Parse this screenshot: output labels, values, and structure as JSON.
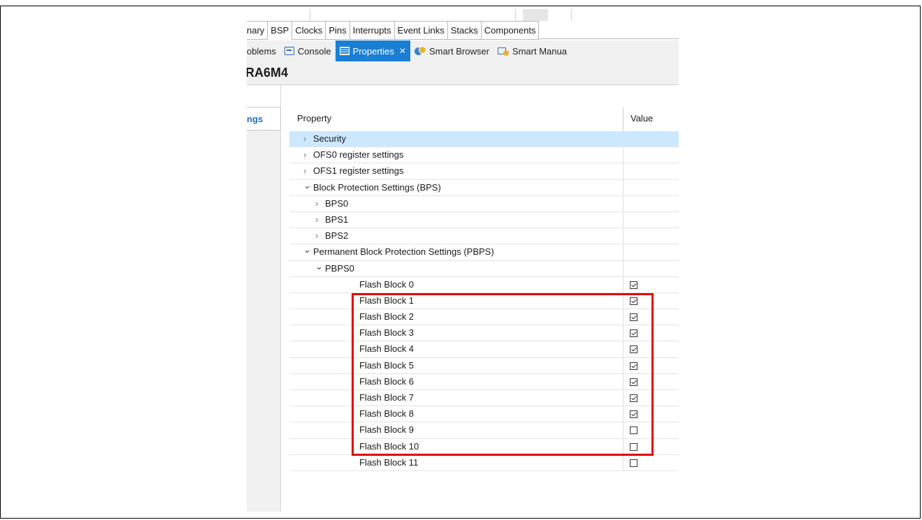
{
  "editor_tabs": [
    "nary",
    "BSP",
    "Clocks",
    "Pins",
    "Interrupts",
    "Event Links",
    "Stacks",
    "Components"
  ],
  "view_tabs": {
    "problems": "oblems",
    "console": "Console",
    "properties": "Properties",
    "smart_browser": "Smart Browser",
    "smart_manual": "Smart Manua"
  },
  "title": "RA6M4",
  "left_tab": "ngs",
  "table": {
    "header_property": "Property",
    "header_value": "Value",
    "rows": [
      {
        "label": "Security",
        "level": 0,
        "expander": "collapsed",
        "selected": true,
        "checkbox": null
      },
      {
        "label": "OFS0 register settings",
        "level": 0,
        "expander": "collapsed",
        "checkbox": null
      },
      {
        "label": "OFS1 register settings",
        "level": 0,
        "expander": "collapsed",
        "checkbox": null
      },
      {
        "label": "Block Protection Settings (BPS)",
        "level": 0,
        "expander": "expanded",
        "checkbox": null
      },
      {
        "label": "BPS0",
        "level": 1,
        "expander": "collapsed",
        "checkbox": null
      },
      {
        "label": "BPS1",
        "level": 1,
        "expander": "collapsed",
        "checkbox": null
      },
      {
        "label": "BPS2",
        "level": 1,
        "expander": "collapsed",
        "checkbox": null
      },
      {
        "label": "Permanent Block Protection Settings (PBPS)",
        "level": 0,
        "expander": "expanded",
        "checkbox": null
      },
      {
        "label": "PBPS0",
        "level": 1,
        "expander": "expanded",
        "checkbox": null
      },
      {
        "label": "Flash Block 0",
        "level": 2,
        "expander": "none",
        "checkbox": true
      },
      {
        "label": "Flash Block 1",
        "level": 2,
        "expander": "none",
        "checkbox": true
      },
      {
        "label": "Flash Block 2",
        "level": 2,
        "expander": "none",
        "checkbox": true
      },
      {
        "label": "Flash Block 3",
        "level": 2,
        "expander": "none",
        "checkbox": true
      },
      {
        "label": "Flash Block 4",
        "level": 2,
        "expander": "none",
        "checkbox": true
      },
      {
        "label": "Flash Block 5",
        "level": 2,
        "expander": "none",
        "checkbox": true
      },
      {
        "label": "Flash Block 6",
        "level": 2,
        "expander": "none",
        "checkbox": true
      },
      {
        "label": "Flash Block 7",
        "level": 2,
        "expander": "none",
        "checkbox": true
      },
      {
        "label": "Flash Block 8",
        "level": 2,
        "expander": "none",
        "checkbox": true
      },
      {
        "label": "Flash Block 9",
        "level": 2,
        "expander": "none",
        "checkbox": false
      },
      {
        "label": "Flash Block 10",
        "level": 2,
        "expander": "none",
        "checkbox": false
      },
      {
        "label": "Flash Block 11",
        "level": 2,
        "expander": "none",
        "checkbox": false
      }
    ]
  },
  "colors": {
    "accent": "#1a7fd4",
    "selected_row": "#cce8ff",
    "highlight_box": "#e00000"
  },
  "icons": {
    "console": "console-icon",
    "properties": "properties-icon",
    "smart_browser": "smart-browser-icon",
    "smart_manual": "smart-manual-icon",
    "close": "close-icon",
    "expander_collapsed": "chevron-right-icon",
    "expander_expanded": "chevron-down-icon"
  }
}
